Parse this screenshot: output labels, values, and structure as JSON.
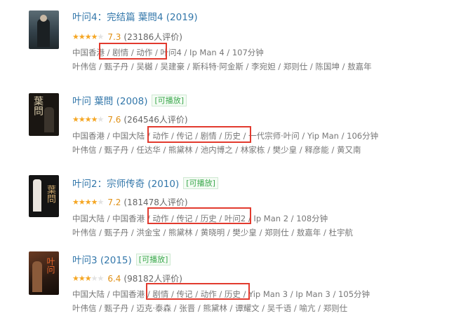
{
  "entries": [
    {
      "title": "叶问4：完结篇 葉問4 (2019)",
      "playable": "",
      "stars": 3.5,
      "score": "7.3",
      "votes": "(23186人评价)",
      "genres": "中国香港 / 剧情 / 动作 / 叶问4 / Ip Man 4 / 107分钟",
      "cast": "叶伟信 / 甄子丹 / 吴樾 / 吴建豪 / 斯科特·阿金斯 / 李宛妲 / 郑则仕 / 陈国坤 / 敖嘉年",
      "poster_bg": "#3a4b52",
      "poster_text": ""
    },
    {
      "title": "叶问 葉問 (2008)",
      "playable": "[可播放]",
      "stars": 4,
      "score": "7.6",
      "votes": "(264546人评价)",
      "genres": "中国香港 / 中国大陆 / 动作 / 传记 / 剧情 / 历史 / 一代宗师·叶问 / Yip Man / 106分钟",
      "cast": "叶伟信 / 甄子丹 / 任达华 / 熊黛林 / 池内博之 / 林家栋 / 樊少皇 / 释彦能 / 黄又南",
      "poster_bg": "#1a1612",
      "poster_text": "葉問"
    },
    {
      "title": "叶问2：宗师传奇 (2010)",
      "playable": "[可播放]",
      "stars": 3.5,
      "score": "7.2",
      "votes": "(181478人评价)",
      "genres": "中国大陆 / 中国香港 / 动作 / 传记 / 历史 / 叶问2 / Ip Man 2 / 108分钟",
      "cast": "叶伟信 / 甄子丹 / 洪金宝 / 熊黛林 / 黄晓明 / 樊少皇 / 郑则仕 / 敖嘉年 / 杜宇航",
      "poster_bg": "#141414",
      "poster_text": "葉問"
    },
    {
      "title": "叶问3 (2015)",
      "playable": "[可播放]",
      "stars": 3,
      "score": "6.4",
      "votes": "(98182人评价)",
      "genres": "中国大陆 / 中国香港 / 剧情 / 传记 / 动作 / 历史 / Yip Man 3 / Ip Man 3 / 105分钟",
      "cast": "叶伟信 / 甄子丹 / 迈克·泰森 / 张晋 / 熊黛林 / 谭耀文 / 吴千语 / 喻亢 / 郑则仕",
      "poster_bg": "#2a1a12",
      "poster_text": "叶问"
    }
  ]
}
